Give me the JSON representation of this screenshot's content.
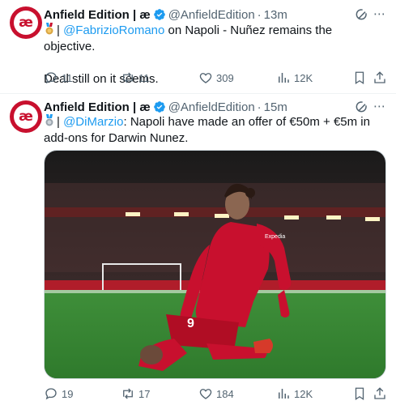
{
  "tweets": [
    {
      "author": "Anfield Edition | æ",
      "handle": "@AnfieldEdition",
      "separator": "·",
      "time": "13m",
      "avatar_icon": "anfield-edition-avatar",
      "mention": "@FabrizioRomano",
      "prefix": "| ",
      "line1_rest": " on Napoli - Nuñez remains the objective.",
      "line2": "Deal still on it seems.",
      "replies": "11",
      "reposts": "11",
      "likes": "309",
      "views": "12K"
    },
    {
      "author": "Anfield Edition | æ",
      "handle": "@AnfieldEdition",
      "separator": "·",
      "time": "15m",
      "avatar_icon": "anfield-edition-avatar",
      "mention": "@DiMarzio",
      "prefix": "| ",
      "text_rest": ": Napoli have made an offer of €50m + €5m in add-ons for Darwin Nunez.",
      "media_alt": "Liverpool player in red kit number 9 kneeling on the pitch celebrating",
      "jersey_number": "9",
      "sponsor": "Expedia",
      "replies": "19",
      "reposts": "17",
      "likes": "184",
      "views": "12K"
    }
  ],
  "colors": {
    "accent": "#1d9bf0",
    "muted": "#536471",
    "brand": "#c8102e"
  }
}
